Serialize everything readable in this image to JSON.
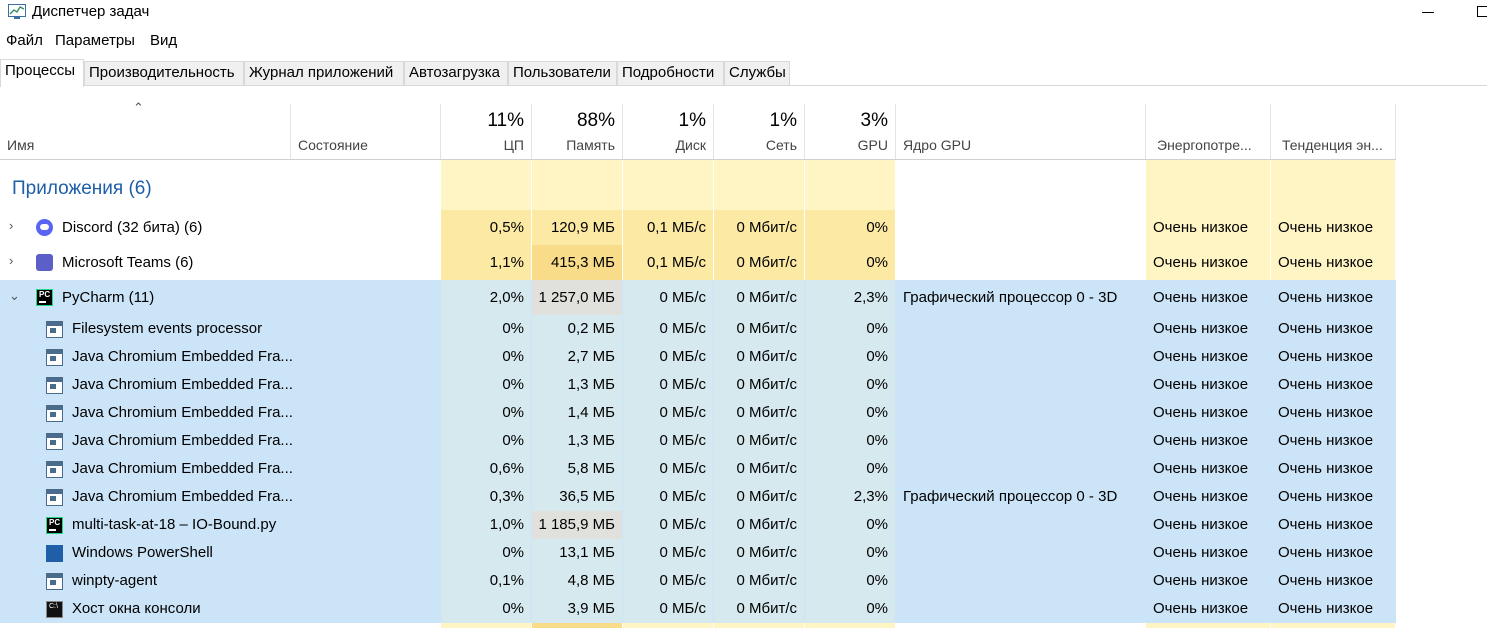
{
  "window": {
    "title": "Диспетчер задач"
  },
  "menu": [
    "Файл",
    "Параметры",
    "Вид"
  ],
  "tabs": [
    "Процессы",
    "Производительность",
    "Журнал приложений",
    "Автозагрузка",
    "Пользователи",
    "Подробности",
    "Службы"
  ],
  "active_tab": "Процессы",
  "columns": {
    "name": {
      "label": "Имя"
    },
    "status": {
      "label": "Состояние"
    },
    "cpu": {
      "pct": "11%",
      "label": "ЦП"
    },
    "mem": {
      "pct": "88%",
      "label": "Память"
    },
    "disk": {
      "pct": "1%",
      "label": "Диск"
    },
    "net": {
      "pct": "1%",
      "label": "Сеть"
    },
    "gpu": {
      "pct": "3%",
      "label": "GPU"
    },
    "gpu_engine": {
      "label": "Ядро GPU"
    },
    "power": {
      "label": "Энергопотре..."
    },
    "power_trend": {
      "label": "Тенденция эн..."
    }
  },
  "colors": {
    "group_title": "#1f5ea8",
    "heat_light": "#fff4c4",
    "heat_mid": "#fce9a4",
    "heat_strong": "#f9dc8a",
    "selected_row": "#cce4f7",
    "selected_heat": "#d6e9ef",
    "selected_heat_strong": "#e0e0dc"
  },
  "group": {
    "title": "Приложения (6)"
  },
  "rows": [
    {
      "name": "Discord (32 бита) (6)",
      "icon": "discord-icon",
      "expander": "›",
      "cpu": "0,5%",
      "mem": "120,9 МБ",
      "disk": "0,1 МБ/с",
      "net": "0 Мбит/с",
      "gpu": "0%",
      "gpu_engine": "",
      "power": "Очень низкое",
      "power_trend": "Очень низкое"
    },
    {
      "name": "Microsoft Teams (6)",
      "icon": "teams-icon",
      "expander": "›",
      "cpu": "1,1%",
      "mem": "415,3 МБ",
      "disk": "0,1 МБ/с",
      "net": "0 Мбит/с",
      "gpu": "0%",
      "gpu_engine": "",
      "power": "Очень низкое",
      "power_trend": "Очень низкое"
    },
    {
      "name": "PyCharm (11)",
      "icon": "pycharm-icon",
      "expander": "⌄",
      "cpu": "2,0%",
      "mem": "1 257,0 МБ",
      "disk": "0 МБ/с",
      "net": "0 Мбит/с",
      "gpu": "2,3%",
      "gpu_engine": "Графический процессор 0 - 3D",
      "power": "Очень низкое",
      "power_trend": "Очень низкое"
    },
    {
      "name": "Filesystem events processor",
      "icon": "process-icon",
      "cpu": "0%",
      "mem": "0,2 МБ",
      "disk": "0 МБ/с",
      "net": "0 Мбит/с",
      "gpu": "0%",
      "gpu_engine": "",
      "power": "Очень низкое",
      "power_trend": "Очень низкое"
    },
    {
      "name": "Java Chromium Embedded Fra...",
      "icon": "process-icon",
      "cpu": "0%",
      "mem": "2,7 МБ",
      "disk": "0 МБ/с",
      "net": "0 Мбит/с",
      "gpu": "0%",
      "gpu_engine": "",
      "power": "Очень низкое",
      "power_trend": "Очень низкое"
    },
    {
      "name": "Java Chromium Embedded Fra...",
      "icon": "process-icon",
      "cpu": "0%",
      "mem": "1,3 МБ",
      "disk": "0 МБ/с",
      "net": "0 Мбит/с",
      "gpu": "0%",
      "gpu_engine": "",
      "power": "Очень низкое",
      "power_trend": "Очень низкое"
    },
    {
      "name": "Java Chromium Embedded Fra...",
      "icon": "process-icon",
      "cpu": "0%",
      "mem": "1,4 МБ",
      "disk": "0 МБ/с",
      "net": "0 Мбит/с",
      "gpu": "0%",
      "gpu_engine": "",
      "power": "Очень низкое",
      "power_trend": "Очень низкое"
    },
    {
      "name": "Java Chromium Embedded Fra...",
      "icon": "process-icon",
      "cpu": "0%",
      "mem": "1,3 МБ",
      "disk": "0 МБ/с",
      "net": "0 Мбит/с",
      "gpu": "0%",
      "gpu_engine": "",
      "power": "Очень низкое",
      "power_trend": "Очень низкое"
    },
    {
      "name": "Java Chromium Embedded Fra...",
      "icon": "process-icon",
      "cpu": "0,6%",
      "mem": "5,8 МБ",
      "disk": "0 МБ/с",
      "net": "0 Мбит/с",
      "gpu": "0%",
      "gpu_engine": "",
      "power": "Очень низкое",
      "power_trend": "Очень низкое"
    },
    {
      "name": "Java Chromium Embedded Fra...",
      "icon": "process-icon",
      "cpu": "0,3%",
      "mem": "36,5 МБ",
      "disk": "0 МБ/с",
      "net": "0 Мбит/с",
      "gpu": "2,3%",
      "gpu_engine": "Графический процессор 0 - 3D",
      "power": "Очень низкое",
      "power_trend": "Очень низкое"
    },
    {
      "name": "multi-task-at-18 – IO-Bound.py",
      "icon": "pycharm-icon",
      "cpu": "1,0%",
      "mem": "1 185,9 МБ",
      "disk": "0 МБ/с",
      "net": "0 Мбит/с",
      "gpu": "0%",
      "gpu_engine": "",
      "power": "Очень низкое",
      "power_trend": "Очень низкое"
    },
    {
      "name": "Windows PowerShell",
      "icon": "powershell-icon",
      "cpu": "0%",
      "mem": "13,1 МБ",
      "disk": "0 МБ/с",
      "net": "0 Мбит/с",
      "gpu": "0%",
      "gpu_engine": "",
      "power": "Очень низкое",
      "power_trend": "Очень низкое"
    },
    {
      "name": "winpty-agent",
      "icon": "process-icon",
      "cpu": "0,1%",
      "mem": "4,8 МБ",
      "disk": "0 МБ/с",
      "net": "0 Мбит/с",
      "gpu": "0%",
      "gpu_engine": "",
      "power": "Очень низкое",
      "power_trend": "Очень низкое"
    },
    {
      "name": "Хост окна консоли",
      "icon": "console-icon",
      "cpu": "0%",
      "mem": "3,9 МБ",
      "disk": "0 МБ/с",
      "net": "0 Мбит/с",
      "gpu": "0%",
      "gpu_engine": "",
      "power": "Очень низкое",
      "power_trend": "Очень низкое"
    }
  ]
}
